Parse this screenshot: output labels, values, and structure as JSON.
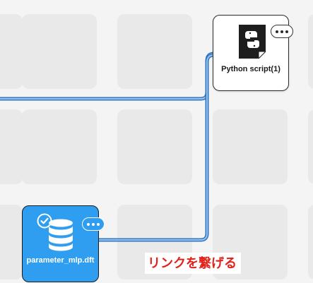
{
  "canvas": {
    "background_color": "#f4f4f4",
    "empty_slot_color": "#e9e9e9",
    "connection_color": "#4a8fd6"
  },
  "nodes": {
    "python_script": {
      "label": "Python script(1)",
      "icon": "python-file-icon",
      "menu_icon": "more-dots-icon",
      "background_color": "#ffffff"
    },
    "dataset": {
      "label": "parameter_mlp.dft",
      "icon": "database-icon",
      "status_icon": "check-circle-icon",
      "menu_icon": "more-dots-icon",
      "background_color": "#2f9ef0"
    }
  },
  "annotation": {
    "text": "リンクを繋げる",
    "color": "#e1231c"
  }
}
